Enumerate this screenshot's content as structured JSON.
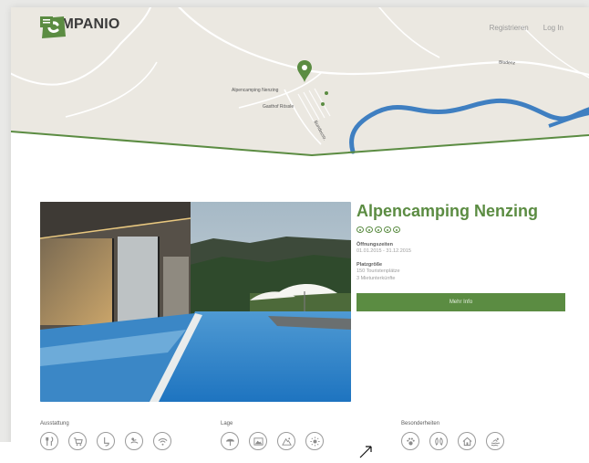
{
  "header": {
    "brand": "CAMPANIO",
    "nav": [
      {
        "label": "Registrieren"
      },
      {
        "label": "Log In"
      }
    ]
  },
  "map": {
    "labels": [
      {
        "text": "Alpencamping Nenzing"
      },
      {
        "text": "Gasthof Rössle"
      },
      {
        "text": "Bundesstr."
      },
      {
        "text": "Bludenz"
      }
    ]
  },
  "campsite": {
    "name": "Alpencamping Nenzing",
    "rating": 5,
    "opening_label": "Öffnungszeiten",
    "opening_value": "01.01.2015 - 31.12.2015",
    "size_label": "Platzgröße",
    "size_line1": "150 Touristenplätze",
    "size_line2": "3 Mietunterkünfte",
    "cta_label": "Mehr Info"
  },
  "amenity_groups": [
    {
      "label": "Ausstattung",
      "icons": [
        "restaurant-icon",
        "shop-icon",
        "toilet-icon",
        "baby-changing-icon",
        "wifi-icon"
      ]
    },
    {
      "label": "Lage",
      "icons": [
        "beach-umbrella-icon",
        "landscape-icon",
        "ski-area-icon",
        "sun-icon"
      ]
    },
    {
      "label": "Besonderheiten",
      "icons": [
        "dog-icon",
        "spa-icon",
        "accommodation-icon",
        "swimming-icon"
      ]
    }
  ],
  "colors": {
    "brand_green": "#5b8c42",
    "river_blue": "#3f7fc1",
    "icon_gray": "#9a9a9a"
  }
}
